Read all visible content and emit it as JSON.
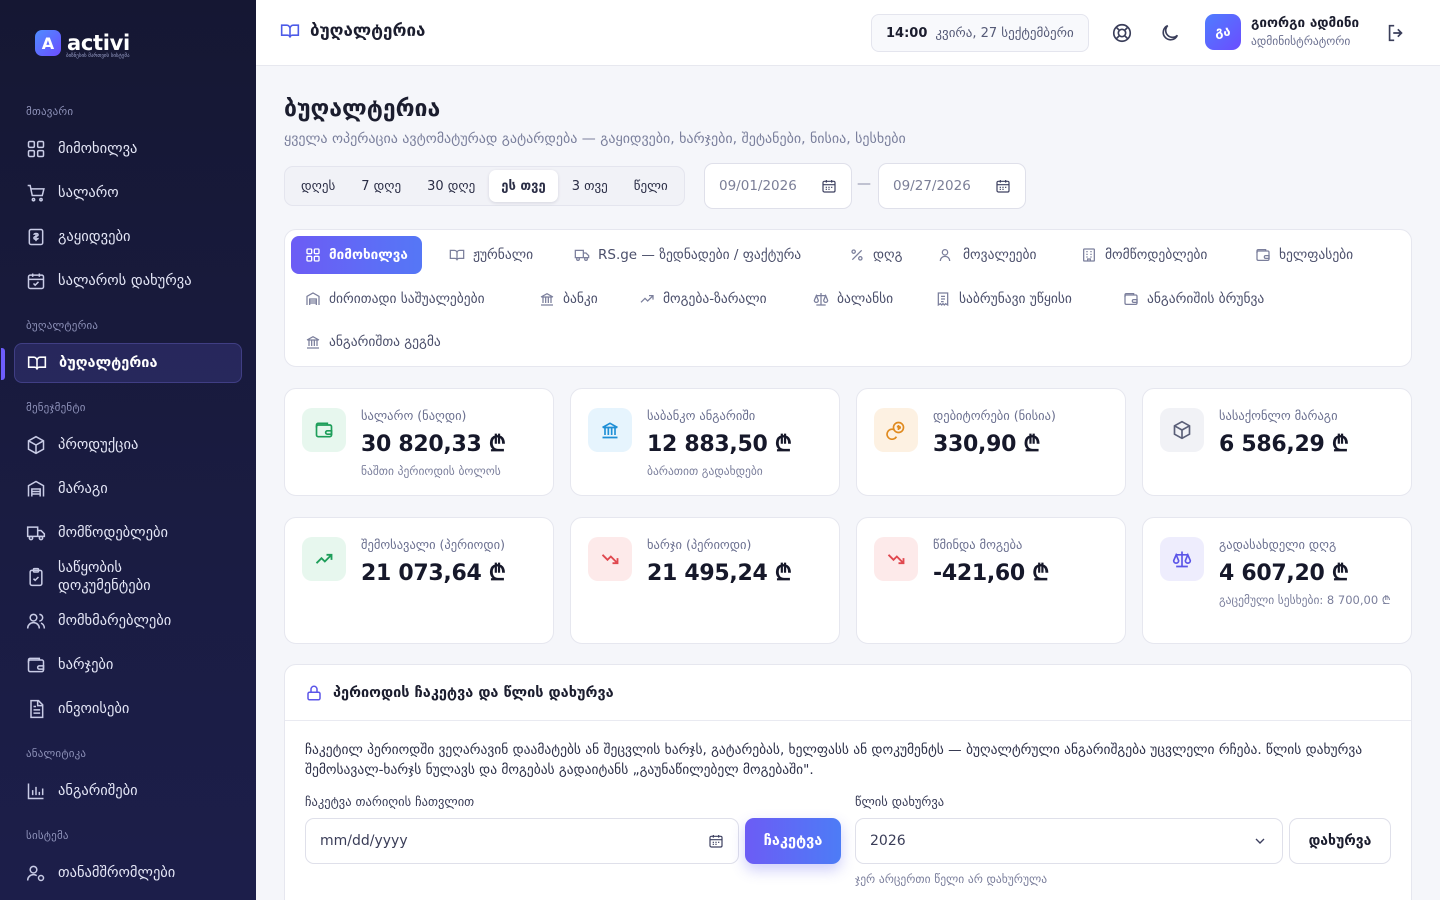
{
  "brand": {
    "name": "activi",
    "tagline": "ბიზნესის მართვის სისტემა"
  },
  "sidebar": {
    "sections": [
      {
        "label": "მთავარი",
        "items": [
          {
            "label": "მიმოხილვა",
            "icon": "grid-icon"
          },
          {
            "label": "სალარო",
            "icon": "cart-icon"
          },
          {
            "label": "გაყიდვები",
            "icon": "receipt-icon"
          },
          {
            "label": "სალაროს დახურვა",
            "icon": "calendar-check-icon"
          }
        ]
      },
      {
        "label": "ბუღალტერია",
        "items": [
          {
            "label": "ბუღალტერია",
            "icon": "book-icon",
            "active": true
          }
        ]
      },
      {
        "label": "მენეჯმენტი",
        "items": [
          {
            "label": "პროდუქცია",
            "icon": "box-icon"
          },
          {
            "label": "მარაგი",
            "icon": "warehouse-icon"
          },
          {
            "label": "მომწოდებლები",
            "icon": "truck-icon"
          },
          {
            "label": "საწყობის დოკუმენტები",
            "icon": "clipboard-icon"
          },
          {
            "label": "მომხმარებლები",
            "icon": "users-icon"
          },
          {
            "label": "ხარჯები",
            "icon": "wallet-icon"
          },
          {
            "label": "ინვოისები",
            "icon": "file-icon"
          }
        ]
      },
      {
        "label": "ანალიტიკა",
        "items": [
          {
            "label": "ანგარიშები",
            "icon": "bar-chart-icon"
          }
        ]
      },
      {
        "label": "სისტემა",
        "items": [
          {
            "label": "თანამშრომლები",
            "icon": "user-gear-icon"
          }
        ]
      }
    ]
  },
  "header": {
    "title": "ბუღალტერია",
    "time": "14:00",
    "date": "კვირა, 27 სექტემბერი",
    "user": {
      "initials": "გა",
      "name": "გიორგი ადმინი",
      "role": "ადმინისტრატორი"
    }
  },
  "page": {
    "title": "ბუღალტერია",
    "subtitle": "ყველა ოპერაცია ავტომატურად გატარდება — გაყიდვები, ხარჯები, შეტანები, ნისია, სესხები"
  },
  "range": {
    "options": [
      "დღეს",
      "7 დღე",
      "30 დღე",
      "ეს თვე",
      "3 თვე",
      "წელი"
    ],
    "active_index": 3,
    "from": "09/01/2026",
    "to": "09/27/2026",
    "separator": "—"
  },
  "tabs": [
    {
      "label": "მიმოხილვა",
      "icon": "grid-icon",
      "active": true
    },
    {
      "label": "ჟურნალი",
      "icon": "book-icon"
    },
    {
      "label": "RS.ge — ზედნადები / ფაქტურა",
      "icon": "truck-icon"
    },
    {
      "label": "დღგ",
      "icon": "percent-icon"
    },
    {
      "label": "მოვალეები",
      "icon": "users-icon"
    },
    {
      "label": "მომწოდებლები",
      "icon": "building-icon"
    },
    {
      "label": "ხელფასები",
      "icon": "wallet-icon"
    },
    {
      "label": "ძირითადი საშუალებები",
      "icon": "warehouse-icon"
    },
    {
      "label": "ბანკი",
      "icon": "bank-icon"
    },
    {
      "label": "მოგება-ზარალი",
      "icon": "trend-up-icon"
    },
    {
      "label": "ბალანსი",
      "icon": "scale-icon"
    },
    {
      "label": "საბრუნავი უწყისი",
      "icon": "receipt-icon"
    },
    {
      "label": "ანგარიშის ბრუნვა",
      "icon": "wallet-icon"
    },
    {
      "label": "ანგარიშთა გეგმა",
      "icon": "bank-icon"
    }
  ],
  "cards": [
    {
      "label": "სალარო (ნაღდი)",
      "value": "30 820,33 ₾",
      "note": "ნაშთი პერიოდის ბოლოს",
      "icon": "wallet-icon",
      "color": "#1e9e5a",
      "bg": "#e7f7ee"
    },
    {
      "label": "საბანკო ანგარიში",
      "value": "12 883,50 ₾",
      "note": "ბარათით გადახდები",
      "icon": "bank-icon",
      "color": "#1f8fd6",
      "bg": "#e6f4fd"
    },
    {
      "label": "დებიტორები (ნისია)",
      "value": "330,90 ₾",
      "note": "",
      "icon": "coins-icon",
      "color": "#e08a1e",
      "bg": "#fdf1e2"
    },
    {
      "label": "სასაქონლო მარაგი",
      "value": "6 586,29 ₾",
      "note": "",
      "icon": "box-icon",
      "color": "#5a5f78",
      "bg": "#f1f2f6"
    },
    {
      "label": "შემოსავალი (პერიოდი)",
      "value": "21 073,64 ₾",
      "note": "",
      "icon": "trend-up-icon",
      "color": "#1e9e5a",
      "bg": "#e7f7ee"
    },
    {
      "label": "ხარჯი (პერიოდი)",
      "value": "21 495,24 ₾",
      "note": "",
      "icon": "trend-down-icon",
      "color": "#e0484f",
      "bg": "#fdeaea"
    },
    {
      "label": "წმინდა მოგება",
      "value": "-421,60 ₾",
      "note": "",
      "icon": "trend-down-icon",
      "color": "#e0484f",
      "bg": "#fdeaea"
    },
    {
      "label": "გადასახდელი დღგ",
      "value": "4 607,20 ₾",
      "note": "გაცემული სესხები: 8 700,00 ₾",
      "icon": "scale-icon",
      "color": "#5b55e8",
      "bg": "#eeedfd"
    }
  ],
  "closing": {
    "title": "პერიოდის ჩაკეტვა და წლის დახურვა",
    "description": "ჩაკეტილ პერიოდში ვეღარავინ დაამატებს ან შეცვლის ხარჯს, გატარებას, ხელფასს ან დოკუმენტს — ბუღალტრული ანგარიშგება უცვლელი რჩება. წლის დახურვა შემოსავალ-ხარჯს ნულავს და მოგებას გადაიტანს „გაუნაწილებელ მოგებაში\".",
    "lock_label": "ჩაკეტვა თარიღის ჩათვლით",
    "lock_placeholder": "mm/dd/yyyy",
    "lock_button": "ჩაკეტვა",
    "year_label": "წლის დახურვა",
    "year_value": "2026",
    "close_button": "დახურვა",
    "year_hint": "ჯერ არცერთი წელი არ დახურულა"
  }
}
